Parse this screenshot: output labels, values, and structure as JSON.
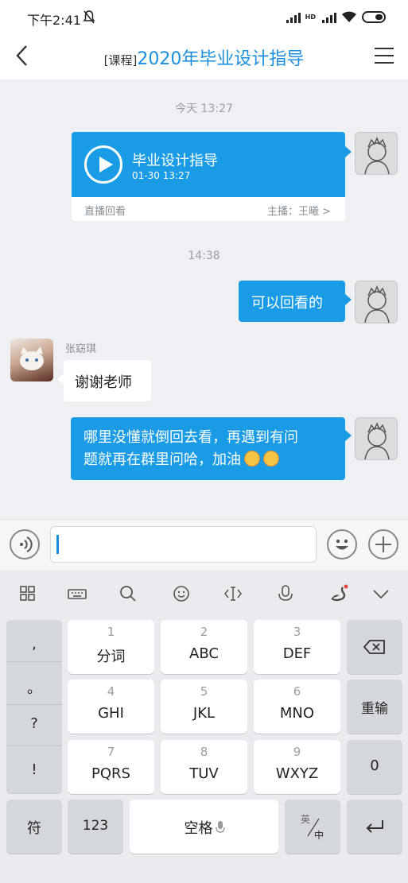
{
  "status_bar": {
    "time": "下午2:41",
    "hd": "HD"
  },
  "header": {
    "back_icon": "back-arrow-icon",
    "tag": "[课程]",
    "title": "2020年毕业设计指导",
    "menu_icon": "hamburger-menu-icon"
  },
  "chat": {
    "stamp1": "今天 13:27",
    "live_card": {
      "title": "毕业设计指导",
      "time": "01-30 13:27",
      "replay_label": "直播回看",
      "host": "主播：王曦",
      "chevron": ">"
    },
    "stamp2": "14:38",
    "msg1": "可以回看的",
    "sender_name": "张窈琪",
    "msg2": "谢谢老师",
    "msg3_line1": "哪里没懂就倒回去看，再遇到有问",
    "msg3_line2": "题就再在群里问哈，加油"
  },
  "input_bar": {
    "voice_icon": "voice-icon",
    "emoji_icon": "emoji-icon",
    "add_icon": "plus-icon",
    "value": ""
  },
  "keyboard": {
    "toolbar_icons": [
      "grid-icon",
      "keyboard-icon",
      "search-icon",
      "smiley-icon",
      "cursor-icon",
      "mic-icon",
      "swan-icon",
      "collapse-icon"
    ],
    "punct": [
      ",",
      "。",
      "?",
      "!"
    ],
    "keys": [
      {
        "num": "1",
        "label": "分词"
      },
      {
        "num": "2",
        "label": "ABC"
      },
      {
        "num": "3",
        "label": "DEF"
      },
      {
        "num": "4",
        "label": "GHI"
      },
      {
        "num": "5",
        "label": "JKL"
      },
      {
        "num": "6",
        "label": "MNO"
      },
      {
        "num": "7",
        "label": "PQRS"
      },
      {
        "num": "8",
        "label": "TUV"
      },
      {
        "num": "9",
        "label": "WXYZ"
      }
    ],
    "reinput": "重输",
    "zero": "0",
    "symbol": "符",
    "num123": "123",
    "space": "空格",
    "lang_top": "英",
    "lang_bottom": "中"
  }
}
